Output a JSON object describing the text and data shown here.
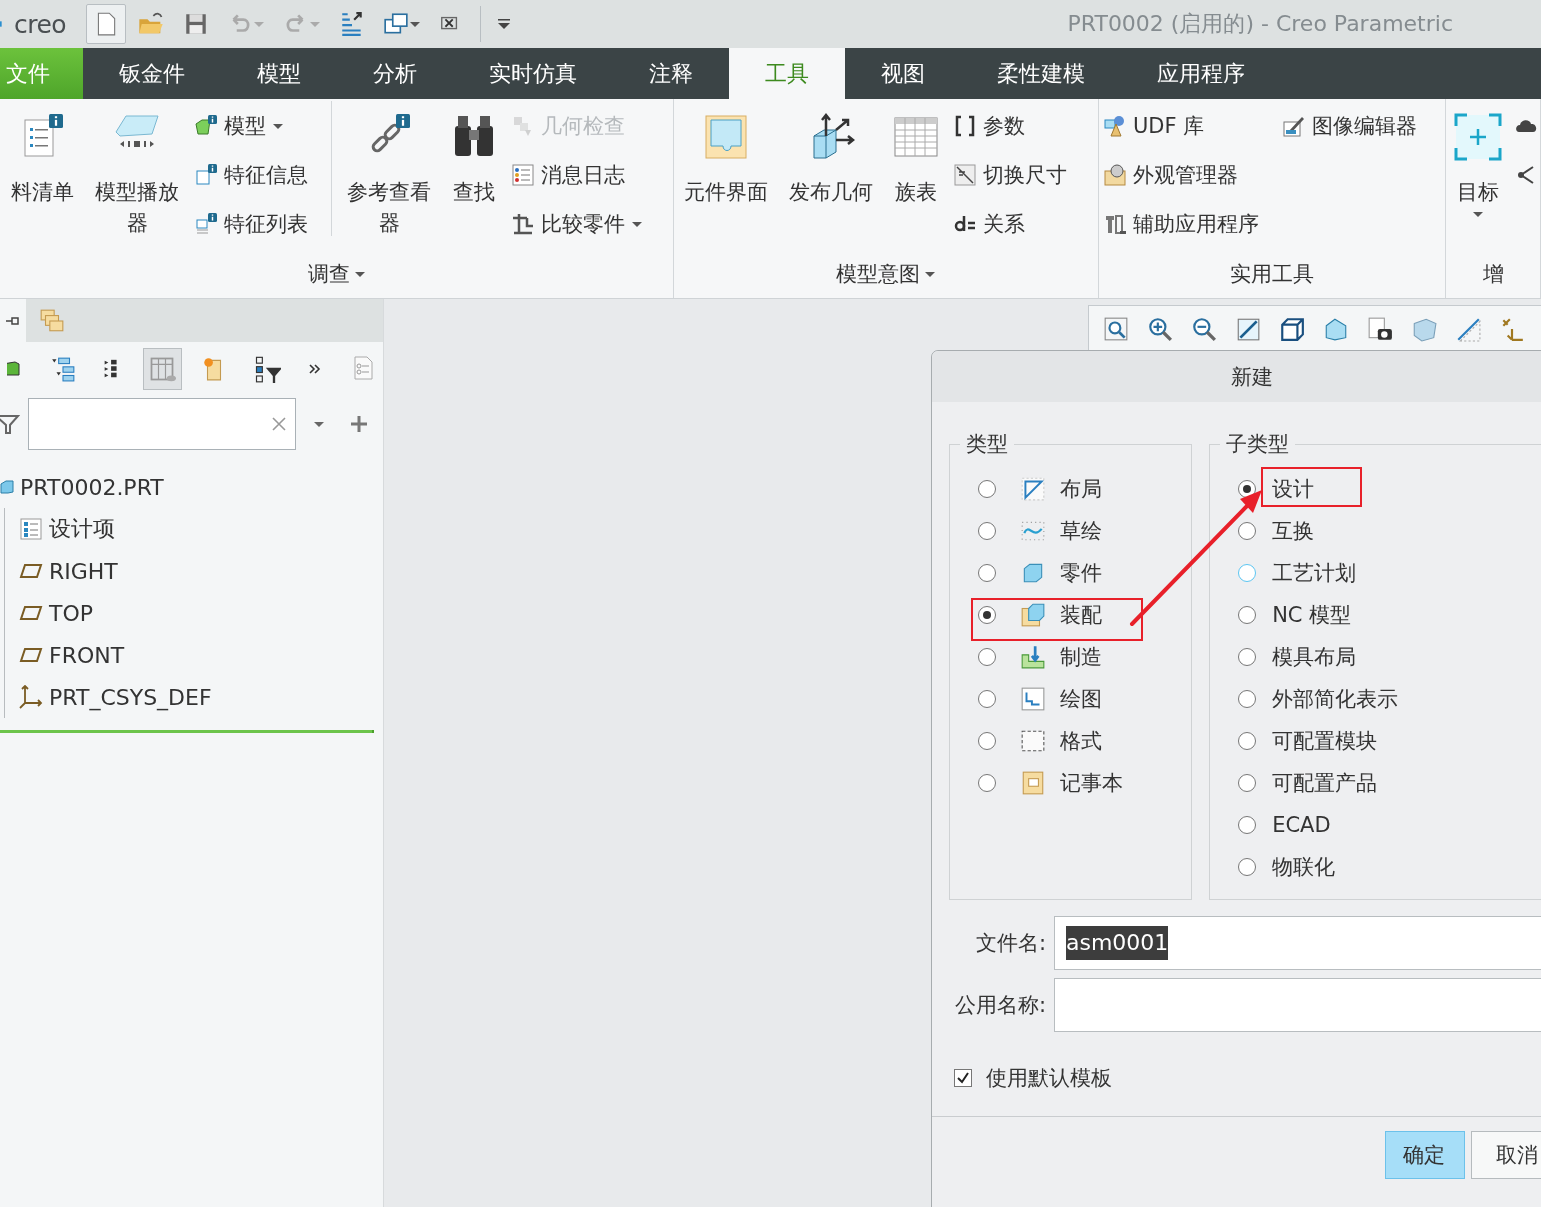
{
  "title_bar": {
    "logo": "creo",
    "title": "PRT0002 (启用的) - Creo Parametric"
  },
  "ribbon_tabs": [
    {
      "label": "文件",
      "kind": "file",
      "selected": false
    },
    {
      "label": "钣金件",
      "kind": "tab",
      "selected": false
    },
    {
      "label": "模型",
      "kind": "tab",
      "selected": false
    },
    {
      "label": "分析",
      "kind": "tab",
      "selected": false
    },
    {
      "label": "实时仿真",
      "kind": "tab",
      "selected": false
    },
    {
      "label": "注释",
      "kind": "tab",
      "selected": false
    },
    {
      "label": "工具",
      "kind": "tab",
      "selected": true
    },
    {
      "label": "视图",
      "kind": "tab",
      "selected": false
    },
    {
      "label": "柔性建模",
      "kind": "tab",
      "selected": false
    },
    {
      "label": "应用程序",
      "kind": "tab",
      "selected": false
    }
  ],
  "ribbon_groups": [
    {
      "label": "调查",
      "menu": true,
      "columns": [
        {
          "kind": "large",
          "label": "料清单",
          "dropdown": false
        },
        {
          "kind": "large",
          "label": "模型播放器",
          "dropdown": false
        },
        {
          "kind": "stack",
          "items": [
            {
              "label": "模型",
              "dropdown": true,
              "disabled": false
            },
            {
              "label": "特征信息",
              "dropdown": false,
              "disabled": false
            },
            {
              "label": "特征列表",
              "dropdown": false,
              "disabled": false
            }
          ]
        },
        {
          "kind": "separator"
        },
        {
          "kind": "large",
          "label": "参考查看器",
          "dropdown": false
        },
        {
          "kind": "large",
          "label": "查找",
          "dropdown": false
        },
        {
          "kind": "stack",
          "items": [
            {
              "label": "几何检查",
              "dropdown": false,
              "disabled": true
            },
            {
              "label": "消息日志",
              "dropdown": false,
              "disabled": false
            },
            {
              "label": "比较零件",
              "dropdown": true,
              "disabled": false
            }
          ]
        }
      ]
    },
    {
      "label": "模型意图",
      "menu": true,
      "columns": [
        {
          "kind": "large",
          "label": "元件界面",
          "dropdown": false
        },
        {
          "kind": "large",
          "label": "发布几何",
          "dropdown": false
        },
        {
          "kind": "large",
          "label": "族表",
          "dropdown": false
        },
        {
          "kind": "stack",
          "items": [
            {
              "label": "参数",
              "dropdown": false,
              "disabled": false
            },
            {
              "label": "切换尺寸",
              "dropdown": false,
              "disabled": false
            },
            {
              "label": "关系",
              "dropdown": false,
              "disabled": false
            }
          ]
        }
      ]
    },
    {
      "label": "实用工具",
      "menu": false,
      "columns": [
        {
          "kind": "stack",
          "items": [
            {
              "label": "UDF 库",
              "dropdown": false,
              "disabled": false
            },
            {
              "label": "外观管理器",
              "dropdown": false,
              "disabled": false
            },
            {
              "label": "辅助应用程序",
              "dropdown": false,
              "disabled": false
            }
          ]
        },
        {
          "kind": "stack",
          "items": [
            {
              "label": "图像编辑器",
              "dropdown": false,
              "disabled": false
            }
          ]
        }
      ]
    },
    {
      "label": "增",
      "menu": false,
      "columns": [
        {
          "kind": "large",
          "label": "目标",
          "dropdown": true
        },
        {
          "kind": "icon_stack"
        }
      ]
    }
  ],
  "panel_tabs": [
    {
      "selected": true
    },
    {
      "selected": false
    }
  ],
  "model_tree": [
    {
      "label": "PRT0002.PRT",
      "kind": "part",
      "children": [
        {
          "label": "设计项",
          "kind": "design_items"
        },
        {
          "label": "RIGHT",
          "kind": "datum_plane"
        },
        {
          "label": "TOP",
          "kind": "datum_plane"
        },
        {
          "label": "FRONT",
          "kind": "datum_plane"
        },
        {
          "label": "PRT_CSYS_DEF",
          "kind": "csys"
        }
      ]
    }
  ],
  "dialog": {
    "title": "新建",
    "type_group": {
      "legend": "类型",
      "options": [
        {
          "label": "布局",
          "selected": false
        },
        {
          "label": "草绘",
          "selected": false
        },
        {
          "label": "零件",
          "selected": false
        },
        {
          "label": "装配",
          "selected": true
        },
        {
          "label": "制造",
          "selected": false
        },
        {
          "label": "绘图",
          "selected": false
        },
        {
          "label": "格式",
          "selected": false
        },
        {
          "label": "记事本",
          "selected": false
        }
      ]
    },
    "subtype_group": {
      "legend": "子类型",
      "options": [
        {
          "label": "设计",
          "selected": true,
          "hovered": false
        },
        {
          "label": "互换",
          "selected": false,
          "hovered": false
        },
        {
          "label": "工艺计划",
          "selected": false,
          "hovered": true
        },
        {
          "label": "NC 模型",
          "selected": false,
          "hovered": false
        },
        {
          "label": "模具布局",
          "selected": false,
          "hovered": false
        },
        {
          "label": "外部简化表示",
          "selected": false,
          "hovered": false
        },
        {
          "label": "可配置模块",
          "selected": false,
          "hovered": false
        },
        {
          "label": "可配置产品",
          "selected": false,
          "hovered": false
        },
        {
          "label": "ECAD",
          "selected": false,
          "hovered": false
        },
        {
          "label": "物联化",
          "selected": false,
          "hovered": false
        }
      ]
    },
    "fields": [
      {
        "label": "文件名:",
        "value": "asm0001",
        "highlighted": true
      },
      {
        "label": "公用名称:"
      }
    ],
    "checkbox": {
      "label": "使用默认模板",
      "checked": true
    },
    "buttons": [
      {
        "label": "确定",
        "kind": "primary"
      },
      {
        "label": "取消",
        "kind": "secondary"
      }
    ]
  }
}
